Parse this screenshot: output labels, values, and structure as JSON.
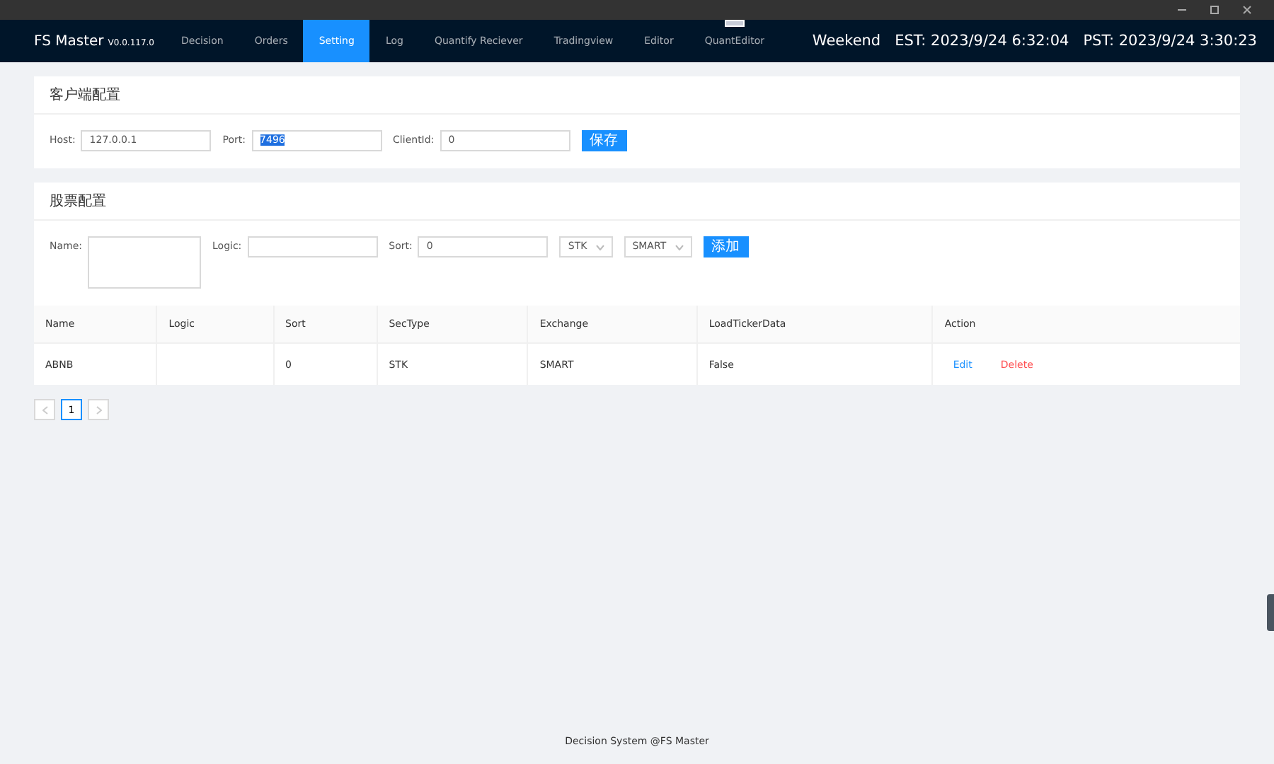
{
  "app": {
    "name": "FS Master",
    "version": "V0.0.117.0"
  },
  "nav": [
    {
      "label": "Decision",
      "selected": false,
      "badge": false
    },
    {
      "label": "Orders",
      "selected": false,
      "badge": false
    },
    {
      "label": "Setting",
      "selected": true,
      "badge": false
    },
    {
      "label": "Log",
      "selected": false,
      "badge": false
    },
    {
      "label": "Quantify Reciever",
      "selected": false,
      "badge": false
    },
    {
      "label": "Tradingview",
      "selected": false,
      "badge": false
    },
    {
      "label": "Editor",
      "selected": false,
      "badge": false
    },
    {
      "label": "QuantEditor",
      "selected": false,
      "badge": true
    }
  ],
  "clock": {
    "day": "Weekend",
    "est": "EST: 2023/9/24 6:32:04",
    "pst": "PST: 2023/9/24 3:30:23"
  },
  "client_config": {
    "title": "客户端配置",
    "fields": [
      {
        "label": "Host:",
        "value": "127.0.0.1",
        "highlighted": false
      },
      {
        "label": "Port:",
        "value": "7496",
        "highlighted": true
      },
      {
        "label": "ClientId:",
        "value": "0",
        "highlighted": false
      }
    ],
    "button": "保存"
  },
  "stock_config": {
    "title": "股票配置",
    "name_label": "Name:",
    "logic_label": "Logic:",
    "sort_label": "Sort:",
    "sort_value": "0",
    "sectype": "STK",
    "exchange": "SMART",
    "button": "添加"
  },
  "table": {
    "columns": [
      "Name",
      "Logic",
      "Sort",
      "SecType",
      "Exchange",
      "LoadTickerData",
      "Action"
    ],
    "rows": [
      {
        "cells": [
          "ABNB",
          "",
          "0",
          "STK",
          "SMART",
          "False"
        ],
        "actions": [
          "Edit",
          "Delete"
        ]
      }
    ]
  },
  "pagination": {
    "pages": [
      {
        "label": "1",
        "selected": true
      }
    ]
  },
  "footer": "Decision System @FS Master"
}
